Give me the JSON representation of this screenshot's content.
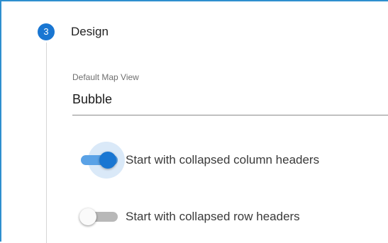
{
  "step": {
    "number": "3",
    "title": "Design"
  },
  "map_view_field": {
    "label": "Default Map View",
    "value": "Bubble"
  },
  "toggles": [
    {
      "label": "Start with collapsed column headers",
      "checked": true
    },
    {
      "label": "Start with collapsed row headers",
      "checked": false
    }
  ],
  "colors": {
    "frame_border": "#2e8fcf",
    "accent": "#1976d2",
    "accent_track": "#5aa2e6",
    "off_track": "#b8b8b8"
  }
}
